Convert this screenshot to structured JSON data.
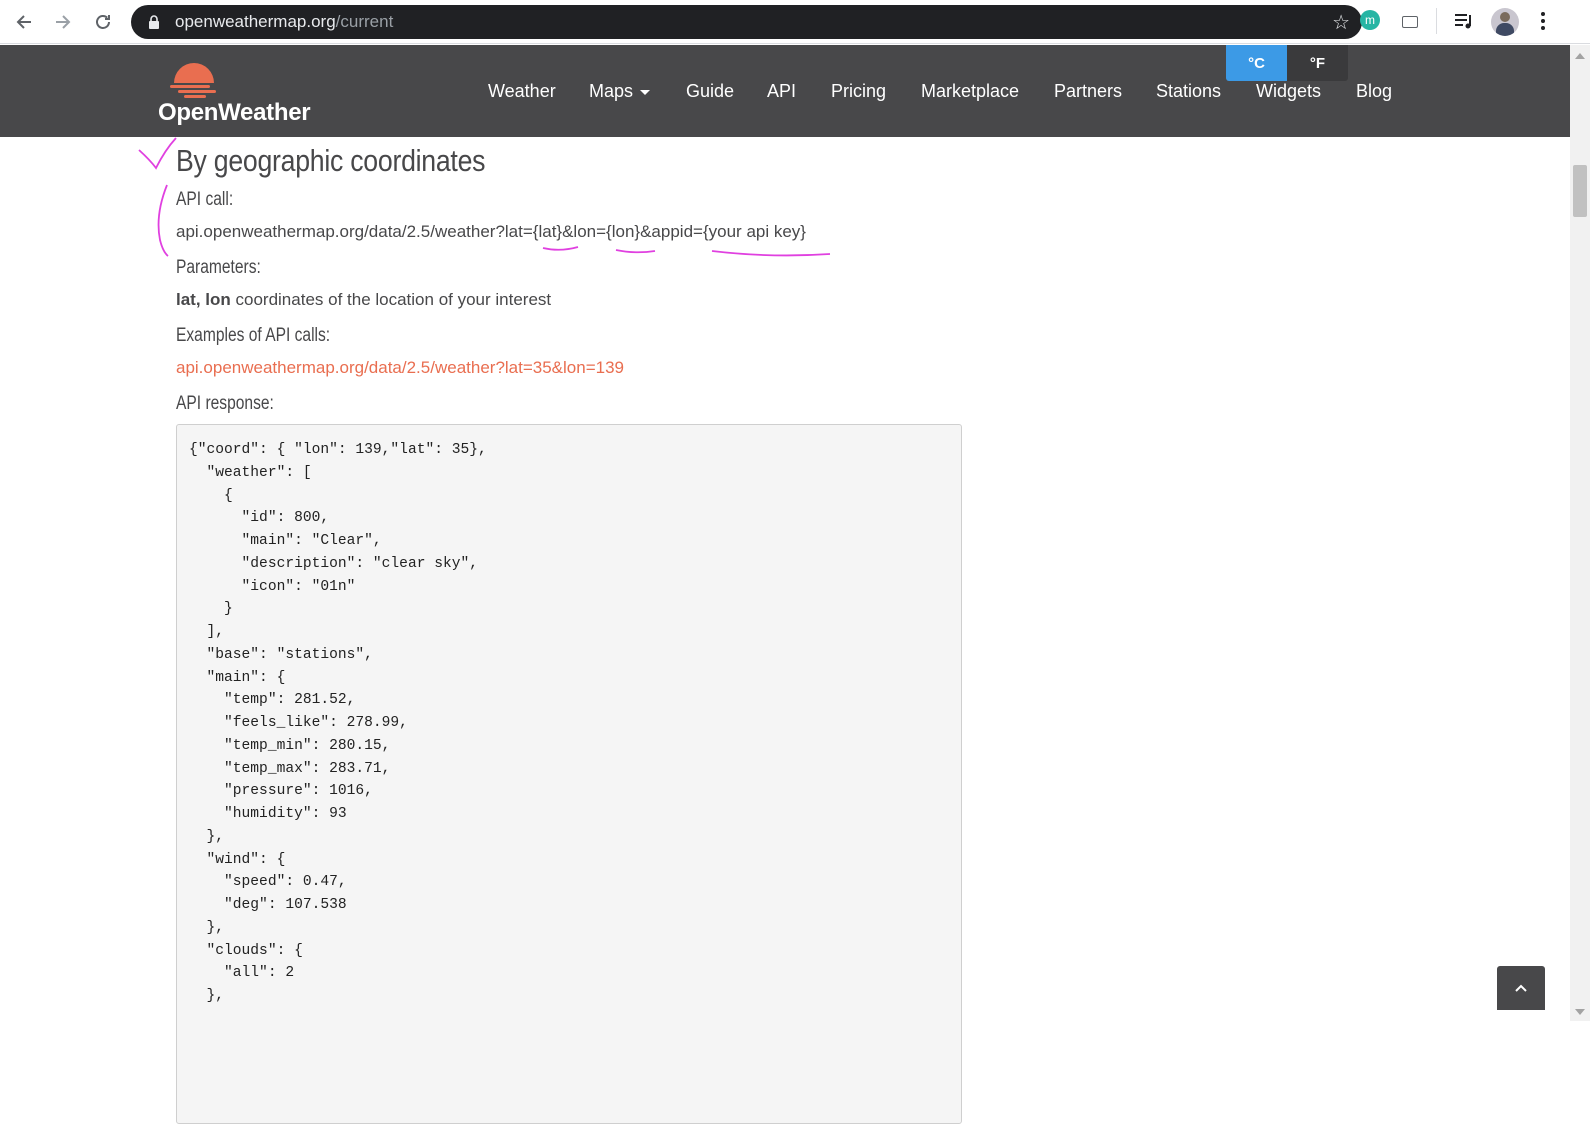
{
  "browser": {
    "url_domain": "openweathermap.org",
    "url_path": "/current",
    "back_icon": "arrow-left-icon",
    "forward_icon": "arrow-right-icon",
    "reload_icon": "reload-icon",
    "bookmark_icon": "star-icon",
    "extension_avatar_letter": "m"
  },
  "header": {
    "logo_text": "OpenWeather",
    "nav": [
      {
        "label": "Weather"
      },
      {
        "label": "Maps"
      },
      {
        "label": "Guide"
      },
      {
        "label": "API"
      },
      {
        "label": "Pricing"
      },
      {
        "label": "Marketplace"
      },
      {
        "label": "Partners"
      },
      {
        "label": "Stations"
      },
      {
        "label": "Widgets"
      },
      {
        "label": "Blog"
      }
    ],
    "unit_celsius": "°C",
    "unit_fahrenheit": "°F",
    "active_unit": "°C",
    "colors": {
      "header_bg": "#48484a",
      "brand_orange": "#e96e50",
      "toggle_active": "#3c9ae6"
    }
  },
  "main": {
    "section_title": "By geographic coordinates",
    "api_call_label": "API call:",
    "api_call_parts": [
      "api.openweathermap.org/data/2.5/weather?lat=",
      "{lat}",
      "&lon=",
      "{lon}",
      "&appid=",
      "{your api key}"
    ],
    "parameters_label": "Parameters:",
    "param_name": "lat, lon",
    "param_desc": " coordinates of the location of your interest",
    "examples_label": "Examples of API calls:",
    "example_link": "api.openweathermap.org/data/2.5/weather?lat=35&lon=139",
    "response_label": "API response:",
    "response_code": "{\"coord\": { \"lon\": 139,\"lat\": 35},\n  \"weather\": [\n    {\n      \"id\": 800,\n      \"main\": \"Clear\",\n      \"description\": \"clear sky\",\n      \"icon\": \"01n\"\n    }\n  ],\n  \"base\": \"stations\",\n  \"main\": {\n    \"temp\": 281.52,\n    \"feels_like\": 278.99,\n    \"temp_min\": 280.15,\n    \"temp_max\": 283.71,\n    \"pressure\": 1016,\n    \"humidity\": 93\n  },\n  \"wind\": {\n    \"speed\": 0.47,\n    \"deg\": 107.538\n  },\n  \"clouds\": {\n    \"all\": 2\n  },"
  },
  "annotation_color": "#e040e0"
}
